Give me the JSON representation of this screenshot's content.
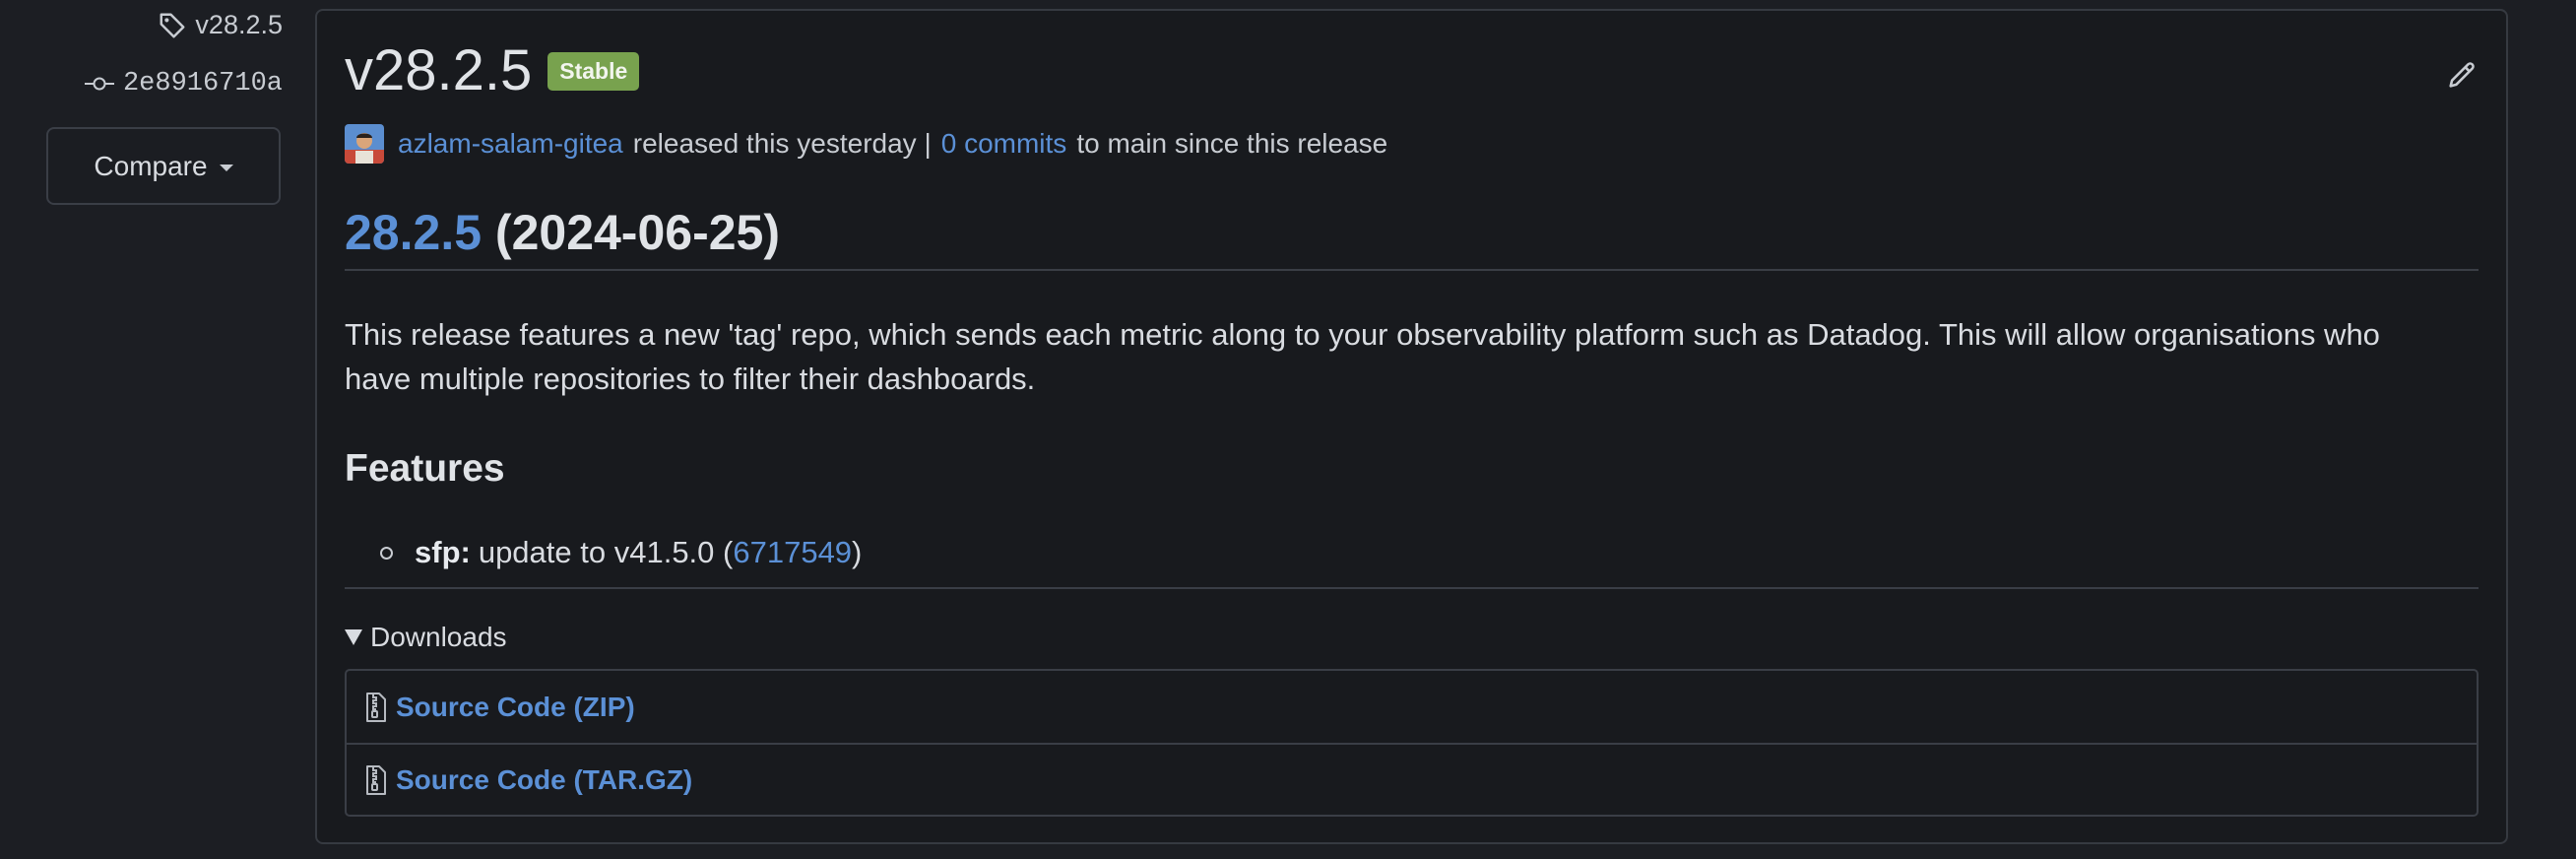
{
  "sidebar": {
    "tag_label": "v28.2.5",
    "commit_label": "2e8916710a",
    "compare_label": "Compare"
  },
  "release": {
    "title": "v28.2.5",
    "badge": "Stable",
    "author": "azlam-salam-gitea",
    "released_text": "released this yesterday |",
    "commits_link": "0 commits",
    "commits_suffix": "to main since this release",
    "version_link": "28.2.5",
    "version_date": "(2024-06-25)",
    "description": "This release features a new 'tag' repo, which sends each metric along to your observability platform such as Datadog. This will allow organisations who have multiple repositories to filter their dashboards.",
    "features_heading": "Features",
    "features": [
      {
        "scope": "sfp:",
        "text": "update to v41.5.0 (",
        "commit": "6717549",
        "close": ")"
      }
    ]
  },
  "downloads": {
    "summary": "Downloads",
    "items": [
      {
        "label": "Source Code (ZIP)"
      },
      {
        "label": "Source Code (TAR.GZ)"
      }
    ]
  },
  "colors": {
    "background": "#1c1e23",
    "card": "#181a1e",
    "link": "#5b90d6",
    "badge": "#78a24e"
  },
  "icons": [
    "tag-icon",
    "git-commit-icon",
    "caret-down-icon",
    "pencil-icon",
    "avatar",
    "file-zip-icon"
  ]
}
